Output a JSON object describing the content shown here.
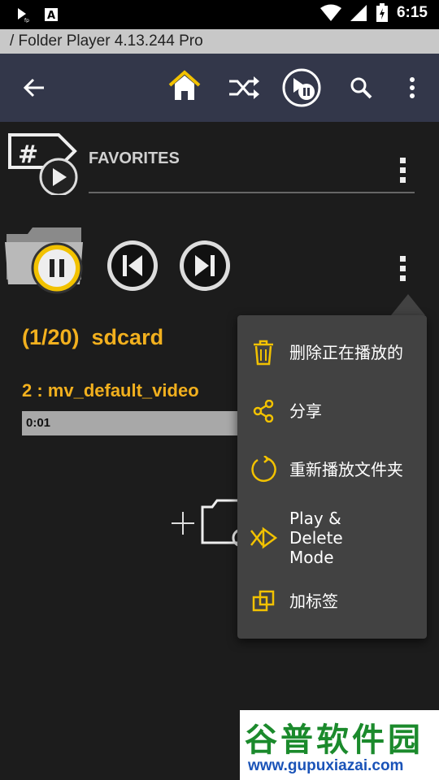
{
  "status_bar": {
    "time": "6:15",
    "icons": [
      "play-small-icon",
      "font-a-icon",
      "wifi-icon",
      "signal-icon",
      "battery-charging-icon"
    ]
  },
  "title_strip": {
    "text": "/ Folder Player 4.13.244  Pro"
  },
  "toolbar": {
    "icons": [
      "back-arrow-icon",
      "home-icon",
      "shuffle-icon",
      "play-pause-circle-icon",
      "search-icon",
      "overflow-menu-icon"
    ],
    "accent": "#f2c200",
    "background": "#33374a"
  },
  "favorites": {
    "label": "FAVORITES"
  },
  "player": {
    "folder_title": "(1/20)  sdcard",
    "track_title": "2 : mv_default_video",
    "elapsed": "0:01",
    "accent": "#f2b01e"
  },
  "menu": {
    "items": [
      {
        "icon": "trash-icon",
        "label": "删除正在播放的"
      },
      {
        "icon": "share-icon",
        "label": "分享"
      },
      {
        "icon": "replay-icon",
        "label": "重新播放文件夹"
      },
      {
        "icon": "play-delete-icon",
        "label": "Play &\nDelete\nMode"
      },
      {
        "icon": "tag-icon",
        "label": "加标签"
      }
    ]
  },
  "watermark": {
    "title": "谷普软件园",
    "url": "www.gupuxiazai.com"
  }
}
